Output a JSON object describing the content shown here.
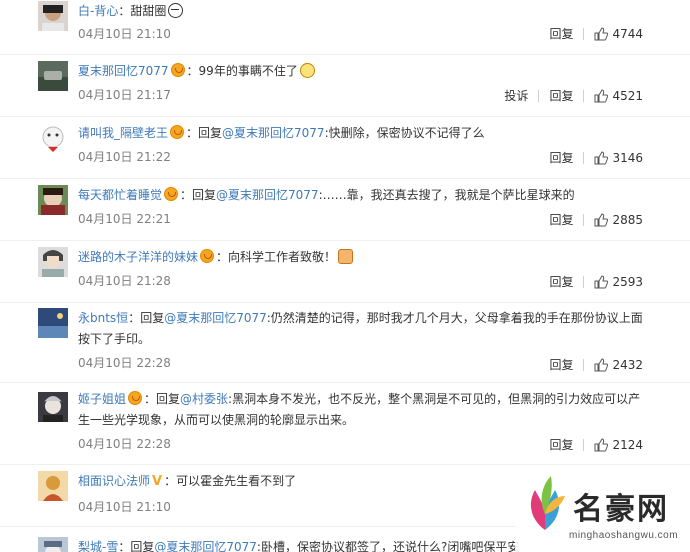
{
  "comments": [
    {
      "user": "白-背心",
      "body": "：甜甜圈",
      "date": "04月10日 21:10",
      "reply_label": "回复",
      "likes": "4744"
    },
    {
      "user": "夏末那回忆7077",
      "body": "：99年的事瞒不住了",
      "date": "04月10日 21:17",
      "report_label": "投诉",
      "reply_label": "回复",
      "likes": "4521"
    },
    {
      "user": "请叫我_隔壁老王",
      "reply_prefix": "：回复",
      "mention": "@夏末那回忆7077",
      "body": ":快删除，保密协议不记得了么",
      "date": "04月10日 21:22",
      "reply_label": "回复",
      "likes": "3146"
    },
    {
      "user": "每天都忙着睡觉",
      "reply_prefix": "：回复",
      "mention": "@夏末那回忆7077",
      "body": ":……靠，我还真去搜了，我就是个萨比星球来的",
      "date": "04月10日 22:21",
      "reply_label": "回复",
      "likes": "2885"
    },
    {
      "user": "迷路的木子洋洋的妹妹",
      "body": "：向科学工作者致敬！",
      "date": "04月10日 21:28",
      "reply_label": "回复",
      "likes": "2593"
    },
    {
      "user": "永bnts恒",
      "reply_prefix": "：回复",
      "mention": "@夏末那回忆7077",
      "body_line1": ":仍然清楚的记得，那时我才几个月大，父母拿着我的手在那份协议上面",
      "body_line2": "按下了手印。",
      "date": "04月10日 22:28",
      "reply_label": "回复",
      "likes": "2432"
    },
    {
      "user": "姬子姐姐",
      "reply_prefix": "：回复",
      "mention": "@村委张",
      "body_line1": ":黑洞本身不发光，也不反光，整个黑洞是不可见的，但黑洞的引力效应可以产",
      "body_line2": "生一些光学现象，从而可以使黑洞的轮廓显示出来。",
      "date": "04月10日 22:28",
      "reply_label": "回复",
      "likes": "2124"
    },
    {
      "user": "相面识心法师",
      "body": "：可以霍金先生看不到了",
      "date": "04月10日 21:10"
    },
    {
      "user": "梨城-雪",
      "reply_prefix": "：回复",
      "mention": "@夏末那回忆7077",
      "body": ":卧槽，保密协议都签了，还说什么?闭嘴吧保平安"
    }
  ],
  "watermark": {
    "name": "名豪网",
    "url": "minghaoshangwu.com"
  },
  "colors": {
    "username": "#eb7350",
    "mention": "#3f7ab8",
    "date": "#808080",
    "vip_badge": "#f5a623"
  }
}
